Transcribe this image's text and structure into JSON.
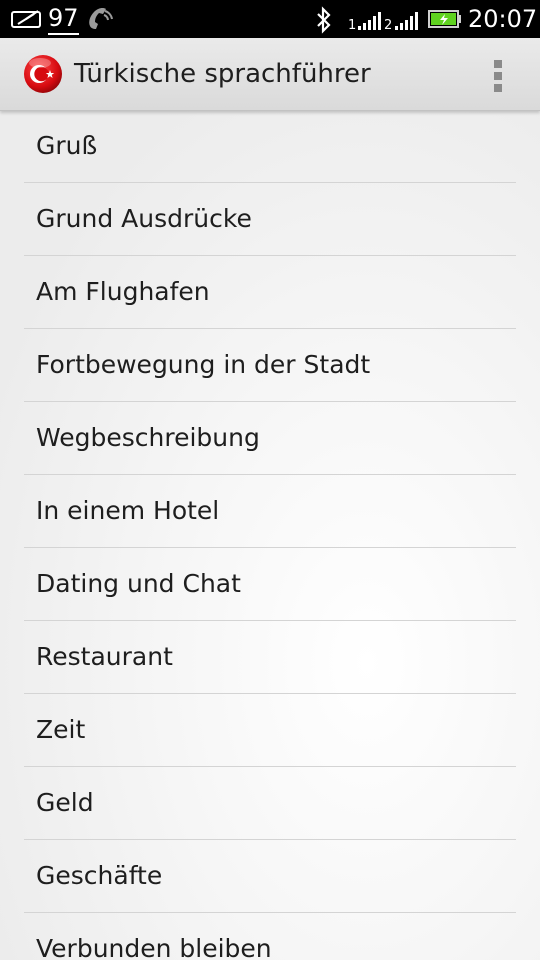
{
  "status_bar": {
    "notification_count": "97",
    "time": "20:07",
    "icons": [
      "card-icon",
      "phone-icon",
      "bluetooth-icon",
      "signal-1-icon",
      "signal-2-icon",
      "battery-charging-icon"
    ]
  },
  "app": {
    "title": "Türkische sprachführer",
    "icon": "turkish-flag-icon",
    "menu_icon": "overflow-menu-icon"
  },
  "categories": [
    "Gruß",
    "Grund Ausdrücke",
    "Am Flughafen",
    "Fortbewegung in der Stadt",
    "Wegbeschreibung",
    "In einem Hotel",
    "Dating und Chat",
    "Restaurant",
    "Zeit",
    "Geld",
    "Geschäfte",
    "Verbunden bleiben"
  ],
  "colors": {
    "flag_red": "#e30a17",
    "battery_green": "#5fd21f",
    "text": "#1e1e1e"
  }
}
